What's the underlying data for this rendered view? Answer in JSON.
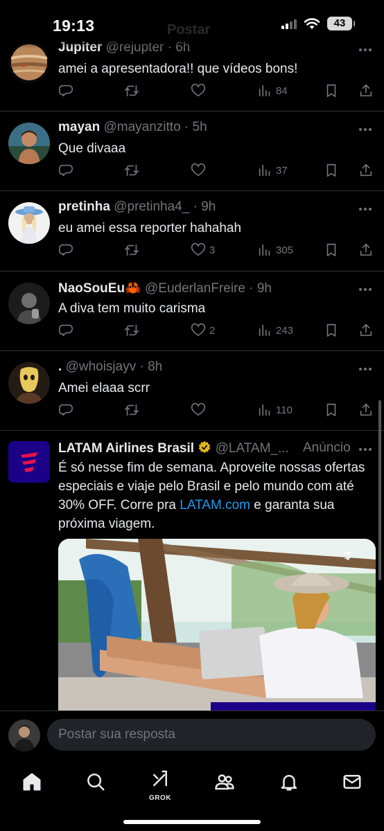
{
  "status_bar": {
    "time": "19:13",
    "battery": "43"
  },
  "header": {
    "title": "Postar"
  },
  "replies": [
    {
      "name": "Jupiter",
      "meta": "@rejupter · 6h",
      "text": "amei a apresentadora!! que vídeos bons!",
      "likes": "",
      "views": "84"
    },
    {
      "name": "mayan",
      "meta": "@mayanzitto · 5h",
      "text": "Que divaaa",
      "likes": "",
      "views": "37"
    },
    {
      "name": "pretinha",
      "meta": "@pretinha4_ · 9h",
      "text": "eu amei essa reporter hahahah",
      "likes": "3",
      "views": "305"
    },
    {
      "name": "NaoSouEu🦀",
      "meta": "@EuderlanFreire · 9h",
      "text": "A diva tem muito carisma",
      "likes": "2",
      "views": "243"
    },
    {
      "name": ".",
      "meta": "@whoisjayv · 8h",
      "text": "Amei elaaa scrr",
      "likes": "",
      "views": "110"
    }
  ],
  "ad": {
    "name": "LATAM Airlines Brasil",
    "meta": "@LATAM_...",
    "label": "Anúncio",
    "text_before": "É só nesse fim de semana. Aproveite nossas ofertas especiais e viaje pelo Brasil e pelo mundo com até 30% OFF. Corre pra ",
    "link": "LATAM.com",
    "text_after": " e garanta sua próxima viagem."
  },
  "reply_bar": {
    "placeholder": "Postar sua resposta"
  },
  "tab_bar": {
    "grok_label": "GROK"
  },
  "colors": {
    "background": "#000000",
    "text": "#e7e9ea",
    "muted": "#71767b",
    "link": "#1d9bf0",
    "verified": "#e2b719",
    "latam": "#1b0088"
  }
}
